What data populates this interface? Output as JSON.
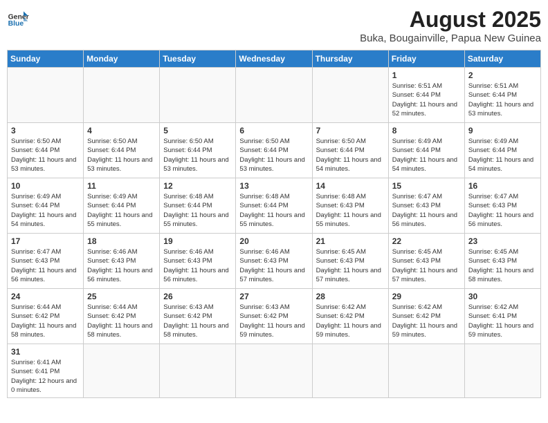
{
  "header": {
    "logo_general": "General",
    "logo_blue": "Blue",
    "month_title": "August 2025",
    "subtitle": "Buka, Bougainville, Papua New Guinea"
  },
  "weekdays": [
    "Sunday",
    "Monday",
    "Tuesday",
    "Wednesday",
    "Thursday",
    "Friday",
    "Saturday"
  ],
  "days": [
    {
      "date": "",
      "info": ""
    },
    {
      "date": "",
      "info": ""
    },
    {
      "date": "",
      "info": ""
    },
    {
      "date": "",
      "info": ""
    },
    {
      "date": "",
      "info": ""
    },
    {
      "date": "1",
      "sunrise": "6:51 AM",
      "sunset": "6:44 PM",
      "daylight": "11 hours and 52 minutes."
    },
    {
      "date": "2",
      "sunrise": "6:51 AM",
      "sunset": "6:44 PM",
      "daylight": "11 hours and 53 minutes."
    },
    {
      "date": "3",
      "sunrise": "6:50 AM",
      "sunset": "6:44 PM",
      "daylight": "11 hours and 53 minutes."
    },
    {
      "date": "4",
      "sunrise": "6:50 AM",
      "sunset": "6:44 PM",
      "daylight": "11 hours and 53 minutes."
    },
    {
      "date": "5",
      "sunrise": "6:50 AM",
      "sunset": "6:44 PM",
      "daylight": "11 hours and 53 minutes."
    },
    {
      "date": "6",
      "sunrise": "6:50 AM",
      "sunset": "6:44 PM",
      "daylight": "11 hours and 53 minutes."
    },
    {
      "date": "7",
      "sunrise": "6:50 AM",
      "sunset": "6:44 PM",
      "daylight": "11 hours and 54 minutes."
    },
    {
      "date": "8",
      "sunrise": "6:49 AM",
      "sunset": "6:44 PM",
      "daylight": "11 hours and 54 minutes."
    },
    {
      "date": "9",
      "sunrise": "6:49 AM",
      "sunset": "6:44 PM",
      "daylight": "11 hours and 54 minutes."
    },
    {
      "date": "10",
      "sunrise": "6:49 AM",
      "sunset": "6:44 PM",
      "daylight": "11 hours and 54 minutes."
    },
    {
      "date": "11",
      "sunrise": "6:49 AM",
      "sunset": "6:44 PM",
      "daylight": "11 hours and 55 minutes."
    },
    {
      "date": "12",
      "sunrise": "6:48 AM",
      "sunset": "6:44 PM",
      "daylight": "11 hours and 55 minutes."
    },
    {
      "date": "13",
      "sunrise": "6:48 AM",
      "sunset": "6:44 PM",
      "daylight": "11 hours and 55 minutes."
    },
    {
      "date": "14",
      "sunrise": "6:48 AM",
      "sunset": "6:43 PM",
      "daylight": "11 hours and 55 minutes."
    },
    {
      "date": "15",
      "sunrise": "6:47 AM",
      "sunset": "6:43 PM",
      "daylight": "11 hours and 56 minutes."
    },
    {
      "date": "16",
      "sunrise": "6:47 AM",
      "sunset": "6:43 PM",
      "daylight": "11 hours and 56 minutes."
    },
    {
      "date": "17",
      "sunrise": "6:47 AM",
      "sunset": "6:43 PM",
      "daylight": "11 hours and 56 minutes."
    },
    {
      "date": "18",
      "sunrise": "6:46 AM",
      "sunset": "6:43 PM",
      "daylight": "11 hours and 56 minutes."
    },
    {
      "date": "19",
      "sunrise": "6:46 AM",
      "sunset": "6:43 PM",
      "daylight": "11 hours and 56 minutes."
    },
    {
      "date": "20",
      "sunrise": "6:46 AM",
      "sunset": "6:43 PM",
      "daylight": "11 hours and 57 minutes."
    },
    {
      "date": "21",
      "sunrise": "6:45 AM",
      "sunset": "6:43 PM",
      "daylight": "11 hours and 57 minutes."
    },
    {
      "date": "22",
      "sunrise": "6:45 AM",
      "sunset": "6:43 PM",
      "daylight": "11 hours and 57 minutes."
    },
    {
      "date": "23",
      "sunrise": "6:45 AM",
      "sunset": "6:43 PM",
      "daylight": "11 hours and 58 minutes."
    },
    {
      "date": "24",
      "sunrise": "6:44 AM",
      "sunset": "6:42 PM",
      "daylight": "11 hours and 58 minutes."
    },
    {
      "date": "25",
      "sunrise": "6:44 AM",
      "sunset": "6:42 PM",
      "daylight": "11 hours and 58 minutes."
    },
    {
      "date": "26",
      "sunrise": "6:43 AM",
      "sunset": "6:42 PM",
      "daylight": "11 hours and 58 minutes."
    },
    {
      "date": "27",
      "sunrise": "6:43 AM",
      "sunset": "6:42 PM",
      "daylight": "11 hours and 59 minutes."
    },
    {
      "date": "28",
      "sunrise": "6:42 AM",
      "sunset": "6:42 PM",
      "daylight": "11 hours and 59 minutes."
    },
    {
      "date": "29",
      "sunrise": "6:42 AM",
      "sunset": "6:42 PM",
      "daylight": "11 hours and 59 minutes."
    },
    {
      "date": "30",
      "sunrise": "6:42 AM",
      "sunset": "6:41 PM",
      "daylight": "11 hours and 59 minutes."
    },
    {
      "date": "31",
      "sunrise": "6:41 AM",
      "sunset": "6:41 PM",
      "daylight": "12 hours and 0 minutes."
    },
    {
      "date": "",
      "info": ""
    },
    {
      "date": "",
      "info": ""
    },
    {
      "date": "",
      "info": ""
    },
    {
      "date": "",
      "info": ""
    },
    {
      "date": "",
      "info": ""
    },
    {
      "date": "",
      "info": ""
    }
  ]
}
